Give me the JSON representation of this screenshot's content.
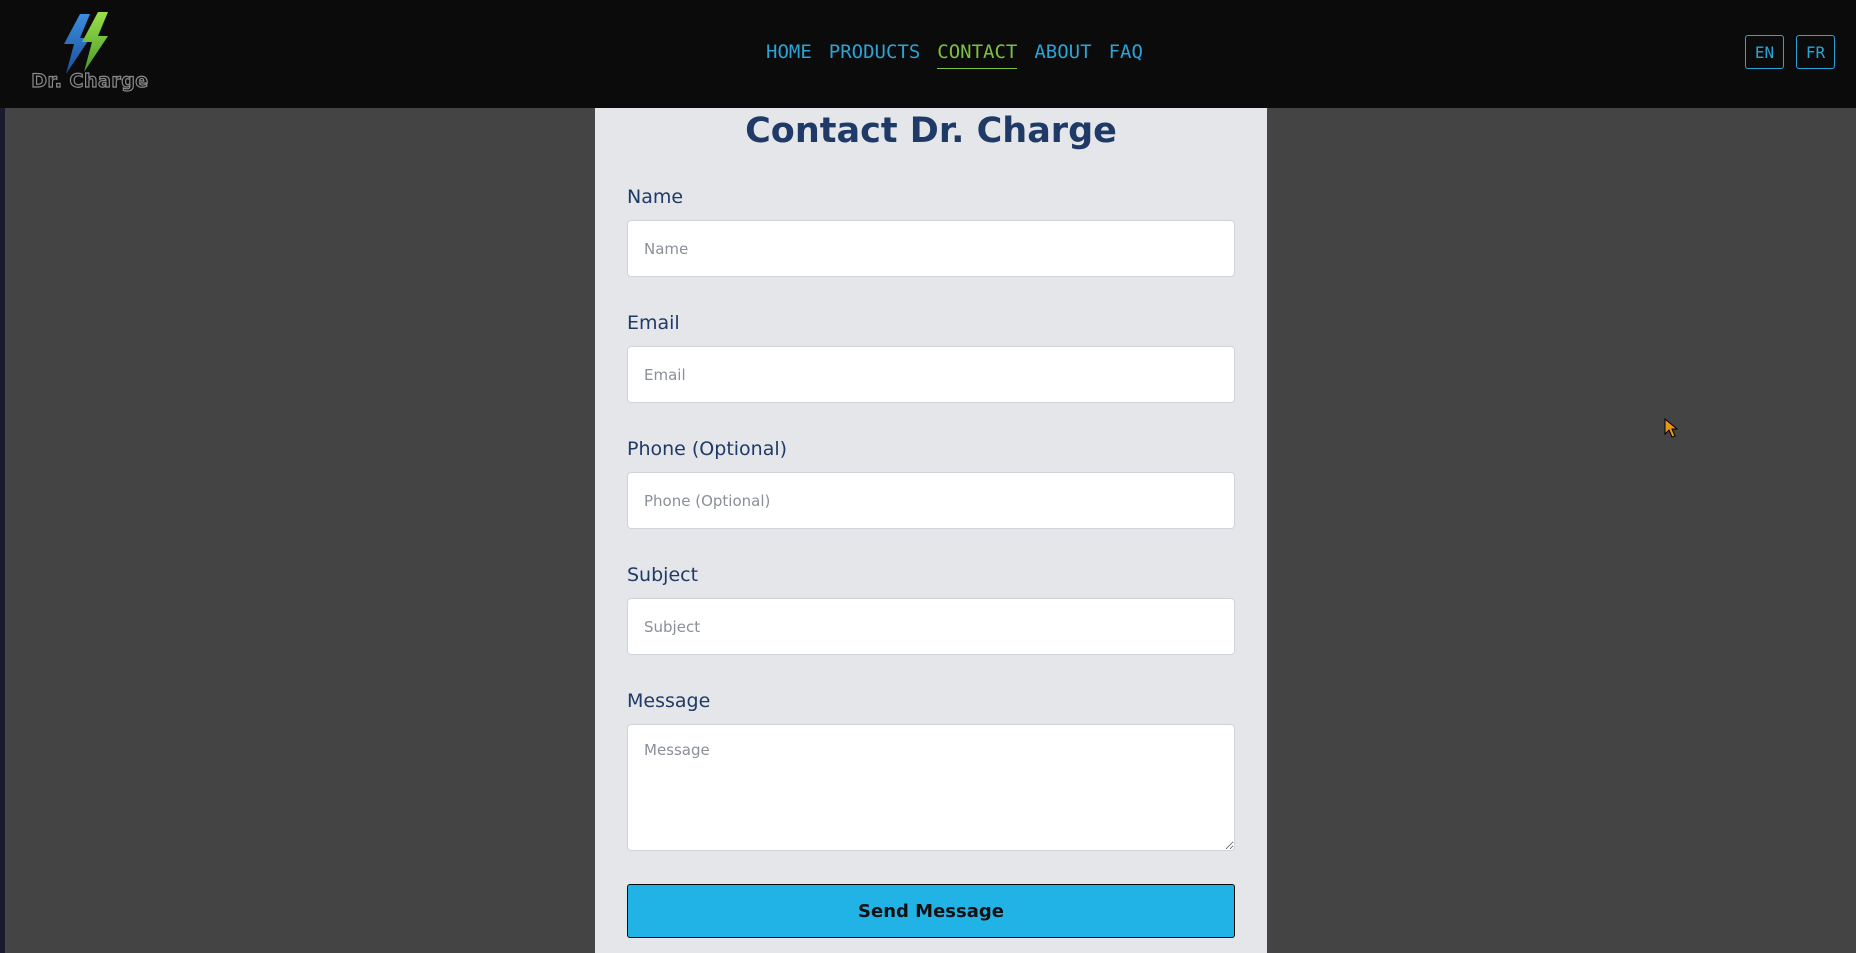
{
  "logo": {
    "text": "Dr. Charge",
    "icon": "lightning-bolt-icon",
    "colors": [
      "#2a7fd6",
      "#7cc040"
    ]
  },
  "nav": {
    "items": [
      {
        "label": "HOME"
      },
      {
        "label": "PRODUCTS"
      },
      {
        "label": "CONTACT",
        "active": true
      },
      {
        "label": "ABOUT"
      },
      {
        "label": "FAQ"
      }
    ]
  },
  "lang": {
    "en": "EN",
    "fr": "FR"
  },
  "form": {
    "title": "Contact Dr. Charge",
    "name_label": "Name",
    "name_placeholder": "Name",
    "email_label": "Email",
    "email_placeholder": "Email",
    "phone_label": "Phone (Optional)",
    "phone_placeholder": "Phone (Optional)",
    "subject_label": "Subject",
    "subject_placeholder": "Subject",
    "message_label": "Message",
    "message_placeholder": "Message",
    "submit_label": "Send Message"
  },
  "colors": {
    "accent": "#2aa3d6",
    "active_nav": "#7cc040",
    "title": "#1f3a66",
    "button": "#22b3e6",
    "background": "#444444",
    "header": "#0b0b0b"
  }
}
